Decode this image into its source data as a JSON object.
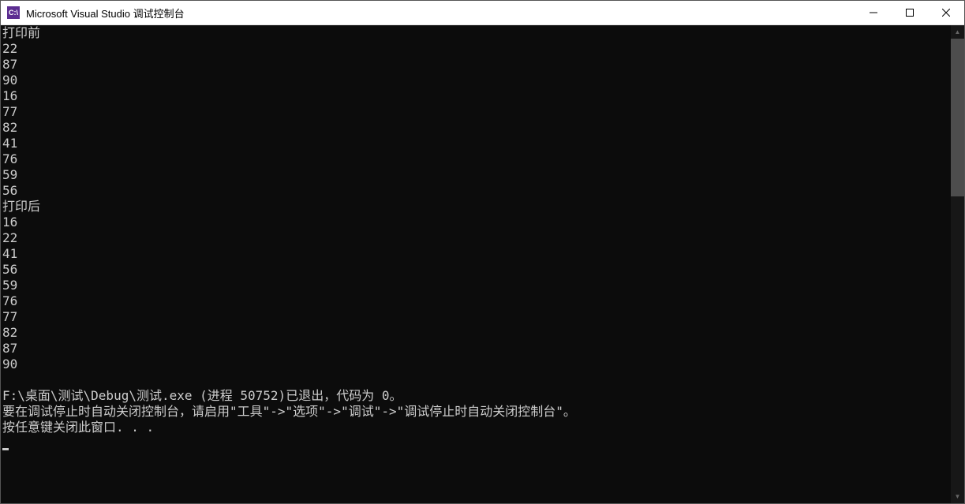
{
  "window": {
    "title": "Microsoft Visual Studio 调试控制台",
    "icon_text": "C:\\"
  },
  "console": {
    "lines": [
      "打印前",
      "22",
      "87",
      "90",
      "16",
      "77",
      "82",
      "41",
      "76",
      "59",
      "56",
      "打印后",
      "16",
      "22",
      "41",
      "56",
      "59",
      "76",
      "77",
      "82",
      "87",
      "90",
      "",
      "F:\\桌面\\测试\\Debug\\测试.exe (进程 50752)已退出，代码为 0。",
      "要在调试停止时自动关闭控制台，请启用\"工具\"->\"选项\"->\"调试\"->\"调试停止时自动关闭控制台\"。",
      "按任意键关闭此窗口. . ."
    ]
  }
}
